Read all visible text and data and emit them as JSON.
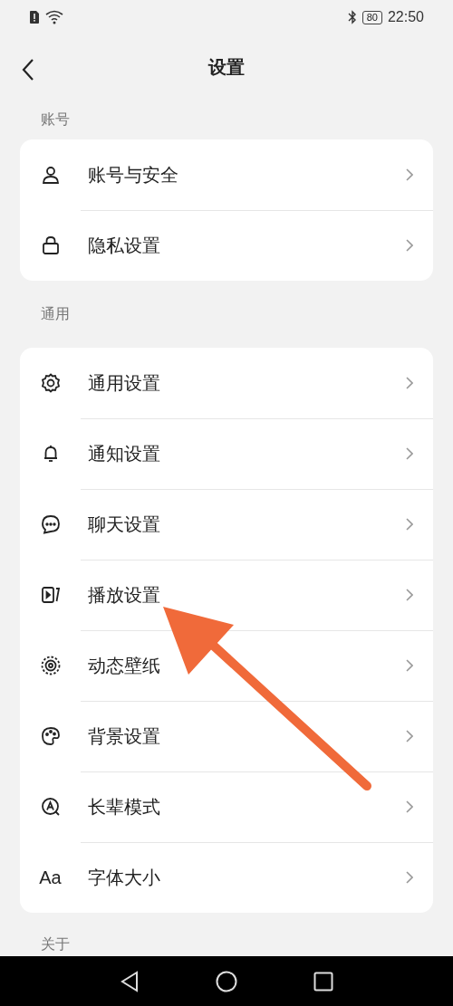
{
  "status_bar": {
    "battery": "80",
    "time": "22:50"
  },
  "header": {
    "title": "设置"
  },
  "sections": [
    {
      "label": "账号",
      "items": [
        {
          "label": "账号与安全"
        },
        {
          "label": "隐私设置"
        }
      ]
    },
    {
      "label": "通用",
      "items": [
        {
          "label": "通用设置"
        },
        {
          "label": "通知设置"
        },
        {
          "label": "聊天设置"
        },
        {
          "label": "播放设置"
        },
        {
          "label": "动态壁纸"
        },
        {
          "label": "背景设置"
        },
        {
          "label": "长辈模式"
        },
        {
          "label": "字体大小",
          "icon_text": "Aa"
        }
      ]
    },
    {
      "label": "关于"
    }
  ]
}
